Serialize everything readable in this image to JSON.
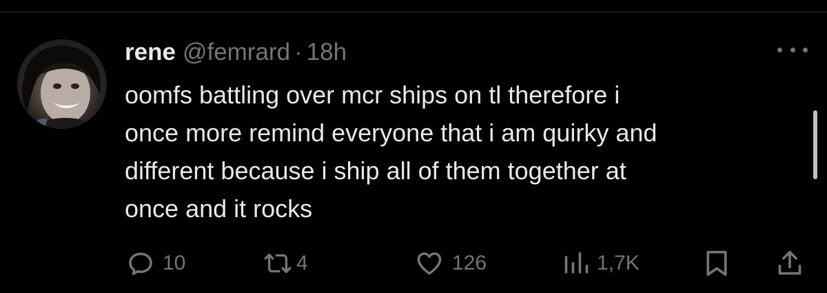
{
  "tweet": {
    "author_name": "rene",
    "author_handle": "@femrard",
    "separator": "·",
    "timestamp": "18h",
    "text_lines": [
      "oomfs battling over mcr ships on tl therefore i",
      "once more remind everyone that i am quirky and",
      "different because i ship all of them together at",
      "once and it rocks"
    ]
  },
  "actions": {
    "replies": "10",
    "retweets": "4",
    "likes": "126",
    "views": "1,7K"
  },
  "icons": {
    "reply": "reply-icon",
    "retweet": "retweet-icon",
    "like": "heart-icon",
    "views": "views-icon",
    "bookmark": "bookmark-icon",
    "share": "share-icon",
    "more": "more-icon"
  },
  "colors": {
    "background": "#000000",
    "text": "#e7e9ea",
    "muted": "#71767b"
  }
}
